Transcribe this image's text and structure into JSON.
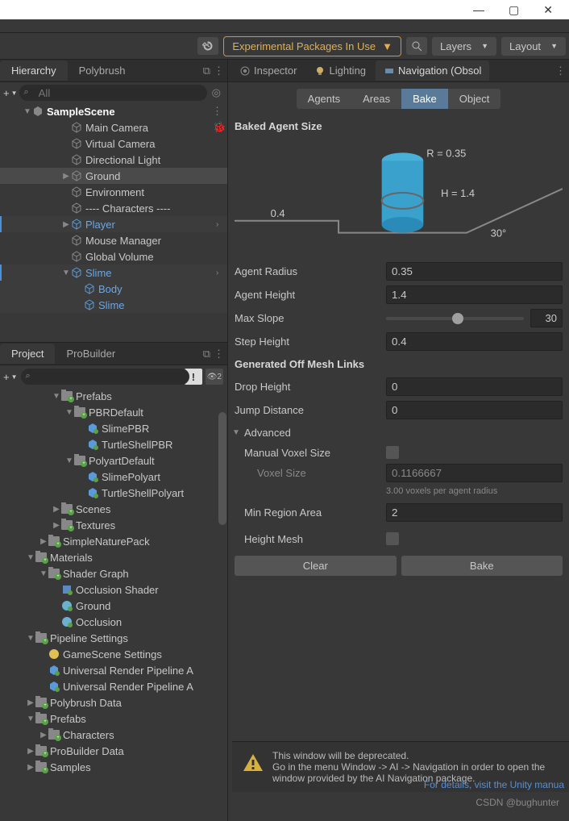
{
  "titlebar": {
    "min": "—",
    "max": "▢",
    "close": "✕"
  },
  "toolbar": {
    "exp_pkg": "Experimental Packages In Use",
    "layers": "Layers",
    "layout": "Layout"
  },
  "left_tabs": {
    "hierarchy": "Hierarchy",
    "polybrush": "Polybrush"
  },
  "search_placeholder": "All",
  "hierarchy": {
    "scene": "SampleScene",
    "items": [
      "Main Camera",
      "Virtual Camera",
      "Directional Light",
      "Ground",
      "Environment",
      "---- Characters ----",
      "Player",
      "Mouse Manager",
      "Global Volume",
      "Slime",
      "Body",
      "Slime"
    ]
  },
  "project_tabs": {
    "project": "Project",
    "probuilder": "ProBuilder"
  },
  "project": {
    "items": [
      {
        "l": 4,
        "f": true,
        "n": "Prefabs",
        "exp": true
      },
      {
        "l": 5,
        "f": true,
        "n": "PBRDefault",
        "exp": true
      },
      {
        "l": 6,
        "f": false,
        "n": "SlimePBR",
        "pf": true
      },
      {
        "l": 6,
        "f": false,
        "n": "TurtleShellPBR",
        "pf": true
      },
      {
        "l": 5,
        "f": true,
        "n": "PolyartDefault",
        "exp": true
      },
      {
        "l": 6,
        "f": false,
        "n": "SlimePolyart",
        "pf": true
      },
      {
        "l": 6,
        "f": false,
        "n": "TurtleShellPolyart",
        "pf": true
      },
      {
        "l": 4,
        "f": true,
        "n": "Scenes"
      },
      {
        "l": 4,
        "f": true,
        "n": "Textures"
      },
      {
        "l": 3,
        "f": true,
        "n": "SimpleNaturePack"
      },
      {
        "l": 2,
        "f": true,
        "n": "Materials",
        "exp": true
      },
      {
        "l": 3,
        "f": true,
        "n": "Shader Graph",
        "exp": true
      },
      {
        "l": 4,
        "f": false,
        "n": "Occlusion Shader",
        "sg": true
      },
      {
        "l": 4,
        "f": false,
        "n": "Ground",
        "mat": true
      },
      {
        "l": 4,
        "f": false,
        "n": "Occlusion",
        "mat": true
      },
      {
        "l": 2,
        "f": true,
        "n": "Pipeline Settings",
        "exp": true
      },
      {
        "l": 3,
        "f": false,
        "n": "GameScene Settings",
        "yel": true
      },
      {
        "l": 3,
        "f": false,
        "n": "Universal Render Pipeline A",
        "pf": true
      },
      {
        "l": 3,
        "f": false,
        "n": "Universal Render Pipeline A",
        "pf": true
      },
      {
        "l": 2,
        "f": true,
        "n": "Polybrush Data"
      },
      {
        "l": 2,
        "f": true,
        "n": "Prefabs",
        "exp": true
      },
      {
        "l": 3,
        "f": true,
        "n": "Characters"
      },
      {
        "l": 2,
        "f": true,
        "n": "ProBuilder Data"
      },
      {
        "l": 2,
        "f": true,
        "n": "Samples"
      }
    ]
  },
  "right_tabs": {
    "inspector": "Inspector",
    "lighting": "Lighting",
    "navigation": "Navigation (Obsol"
  },
  "mode_tabs": [
    "Agents",
    "Areas",
    "Bake",
    "Object"
  ],
  "nav": {
    "baked_title": "Baked Agent Size",
    "viz": {
      "r": "R = 0.35",
      "h": "H = 1.4",
      "step": "0.4",
      "slope": "30°"
    },
    "agent_radius_label": "Agent Radius",
    "agent_radius": "0.35",
    "agent_height_label": "Agent Height",
    "agent_height": "1.4",
    "max_slope_label": "Max Slope",
    "max_slope": "30",
    "step_height_label": "Step Height",
    "step_height": "0.4",
    "gen_title": "Generated Off Mesh Links",
    "drop_label": "Drop Height",
    "drop": "0",
    "jump_label": "Jump Distance",
    "jump": "0",
    "advanced": "Advanced",
    "mvs_label": "Manual Voxel Size",
    "vs_label": "Voxel Size",
    "vs": "0.1166667",
    "vs_help": "3.00 voxels per agent radius",
    "mra_label": "Min Region Area",
    "mra": "2",
    "hm_label": "Height Mesh",
    "clear": "Clear",
    "bake": "Bake"
  },
  "warning": {
    "line1": "This window will be deprecated.",
    "line2": "Go in the menu Window -> AI -> Navigation in order to open the window provided by the AI Navigation package.",
    "link": "For details, visit the Unity manua"
  },
  "watermark": "CSDN @bughunter"
}
